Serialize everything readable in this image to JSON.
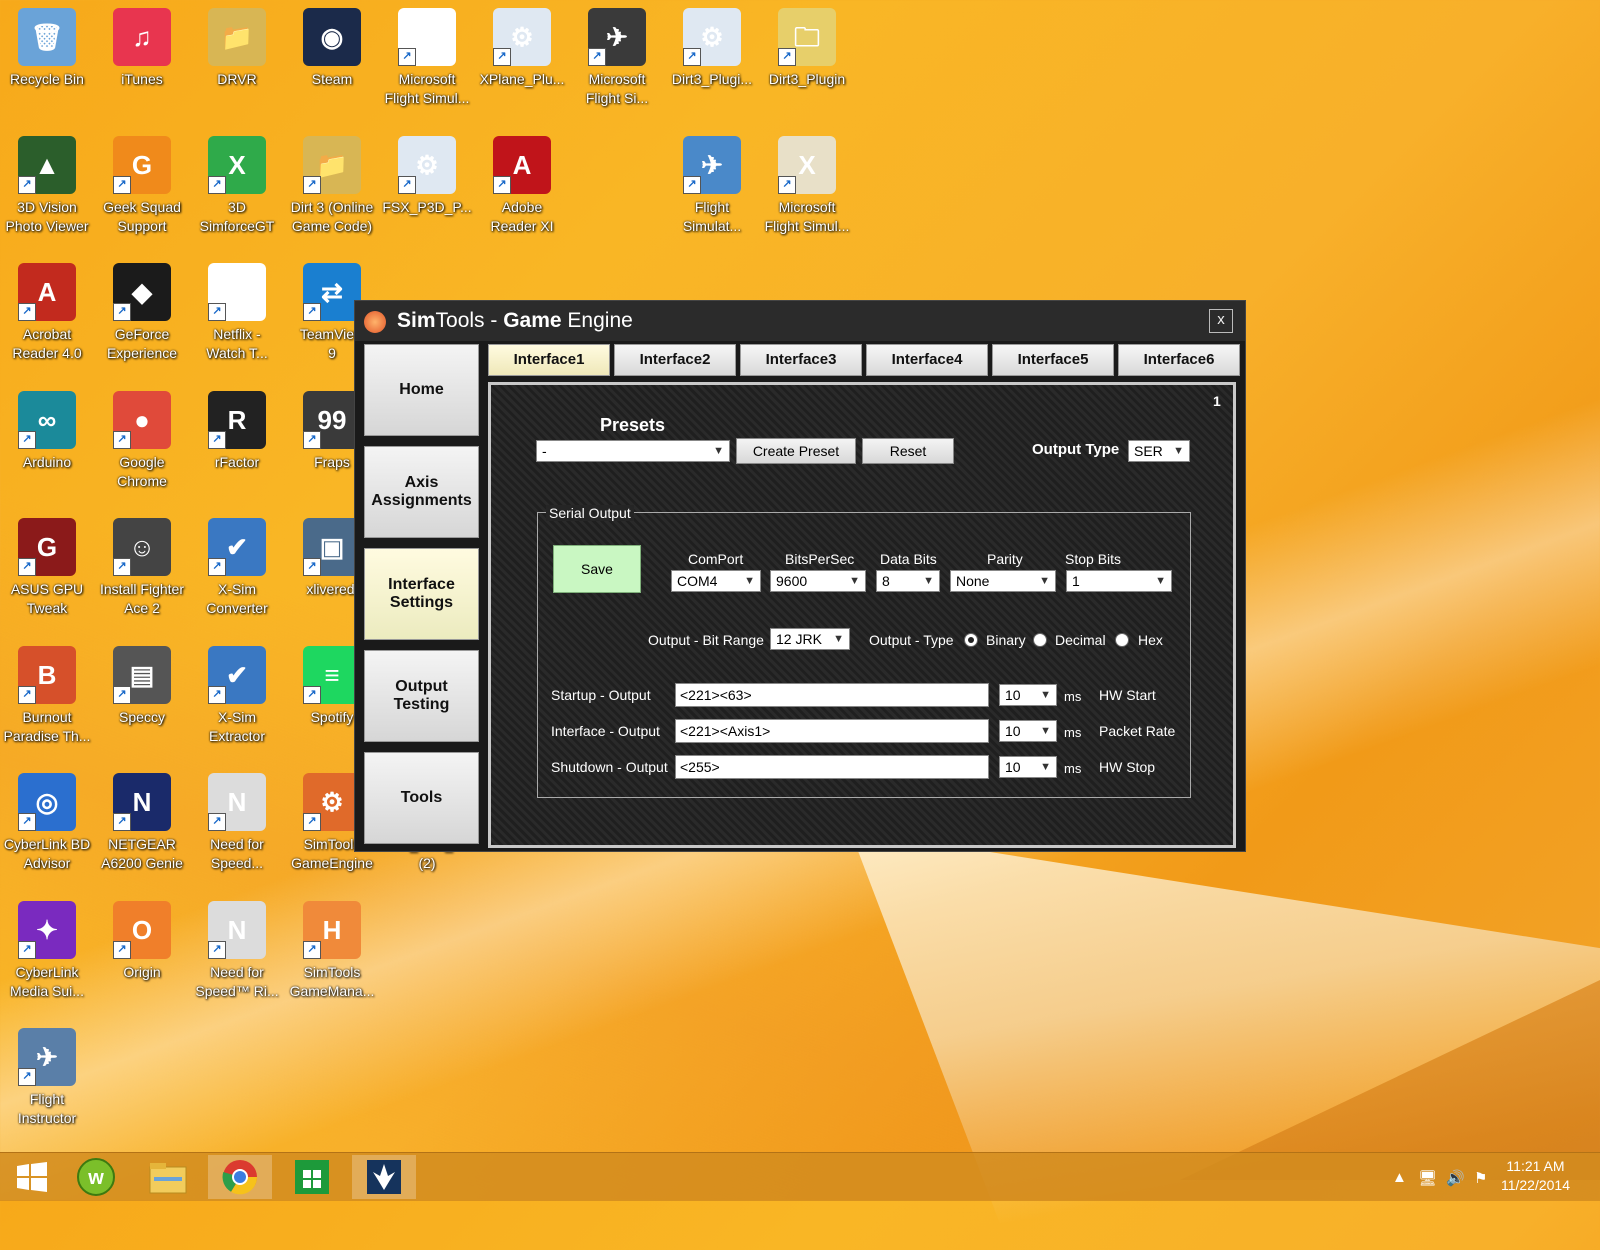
{
  "desktop": {
    "icons": [
      {
        "label": "Recycle Bin"
      },
      {
        "label": "iTunes"
      },
      {
        "label": "DRVR"
      },
      {
        "label": "Steam"
      },
      {
        "label": "Microsoft\nFlight Simul..."
      },
      {
        "label": "XPlane_Plu..."
      },
      {
        "label": "Microsoft\nFlight Si..."
      },
      {
        "label": "Dirt3_Plugi..."
      },
      {
        "label": "Dirt3_Plugin"
      },
      {
        "label": "3D Vision\nPhoto Viewer"
      },
      {
        "label": "Geek Squad\nSupport"
      },
      {
        "label": "3D\nSimforceGT"
      },
      {
        "label": "Dirt 3 (Online\nGame Code)"
      },
      {
        "label": "FSX_P3D_P..."
      },
      {
        "label": "Adobe\nReader XI"
      },
      {
        "label": "Flight\nSimulat..."
      },
      {
        "label": "Microsoft\nFlight Simul..."
      },
      {
        "label": "Acrobat\nReader 4.0"
      },
      {
        "label": "GeForce\nExperience"
      },
      {
        "label": "Netflix -\nWatch T..."
      },
      {
        "label": "TeamView\n9"
      },
      {
        "label": "Arduino"
      },
      {
        "label": "Google\nChrome"
      },
      {
        "label": "rFactor"
      },
      {
        "label": "Fraps"
      },
      {
        "label": "ASUS GPU\nTweak"
      },
      {
        "label": "Install Fighter\nAce 2"
      },
      {
        "label": "X-Sim\nConverter"
      },
      {
        "label": "xliveredi"
      },
      {
        "label": "Burnout\nParadise Th..."
      },
      {
        "label": "Speccy"
      },
      {
        "label": "X-Sim\nExtractor"
      },
      {
        "label": "Spotify"
      },
      {
        "label": "CyberLink BD\nAdvisor"
      },
      {
        "label": "NETGEAR\nA6200 Genie"
      },
      {
        "label": "Need for\nSpeed..."
      },
      {
        "label": "SimTools\nGameEngine"
      },
      {
        "label": "FSX_P3D_P...\n(2)"
      },
      {
        "label": "CyberLink\nMedia Sui..."
      },
      {
        "label": "Origin"
      },
      {
        "label": "Need for\nSpeed™ Ri..."
      },
      {
        "label": "SimTools\nGameMana..."
      },
      {
        "label": "Flight\nInstructor"
      }
    ]
  },
  "window": {
    "title_bold_1": "Sim",
    "title_norm_1": "Tools - ",
    "title_bold_2": "Game",
    "title_norm_2": " Engine",
    "close": "x",
    "nav": {
      "home": "Home",
      "axis": "Axis\nAssignments",
      "interface": "Interface\nSettings",
      "output": "Output\nTesting",
      "tools": "Tools"
    },
    "tabs": [
      "Interface1",
      "Interface2",
      "Interface3",
      "Interface4",
      "Interface5",
      "Interface6"
    ],
    "panel_number": "1",
    "presets": {
      "label": "Presets",
      "value": "-",
      "create": "Create Preset",
      "reset": "Reset"
    },
    "output_type": {
      "label": "Output Type",
      "value": "SER"
    },
    "serial": {
      "legend": "Serial Output",
      "save": "Save",
      "comport": {
        "label": "ComPort",
        "value": "COM4"
      },
      "bitspersec": {
        "label": "BitsPerSec",
        "value": "9600"
      },
      "databits": {
        "label": "Data Bits",
        "value": "8"
      },
      "parity": {
        "label": "Parity",
        "value": "None"
      },
      "stopbits": {
        "label": "Stop Bits",
        "value": "1"
      },
      "bitrange": {
        "label": "Output - Bit Range",
        "value": "12 JRK"
      },
      "outtype": {
        "label": "Output - Type",
        "binary": "Binary",
        "decimal": "Decimal",
        "hex": "Hex",
        "selected": "Binary"
      },
      "startup": {
        "label": "Startup - Output",
        "value": "<221><63>",
        "ms": "10",
        "unit": "ms",
        "note": "HW Start"
      },
      "interface": {
        "label": "Interface - Output",
        "value": "<221><Axis1>",
        "ms": "10",
        "unit": "ms",
        "note": "Packet Rate"
      },
      "shutdown": {
        "label": "Shutdown - Output",
        "value": "<255>",
        "ms": "10",
        "unit": "ms",
        "note": "HW Stop"
      }
    }
  },
  "taskbar": {
    "time": "11:21 AM",
    "date": "11/22/2014"
  },
  "colors": {
    "accent": "#f7a91a",
    "window_bg": "#1a1a1a",
    "save_bg": "#c9f7c2"
  }
}
